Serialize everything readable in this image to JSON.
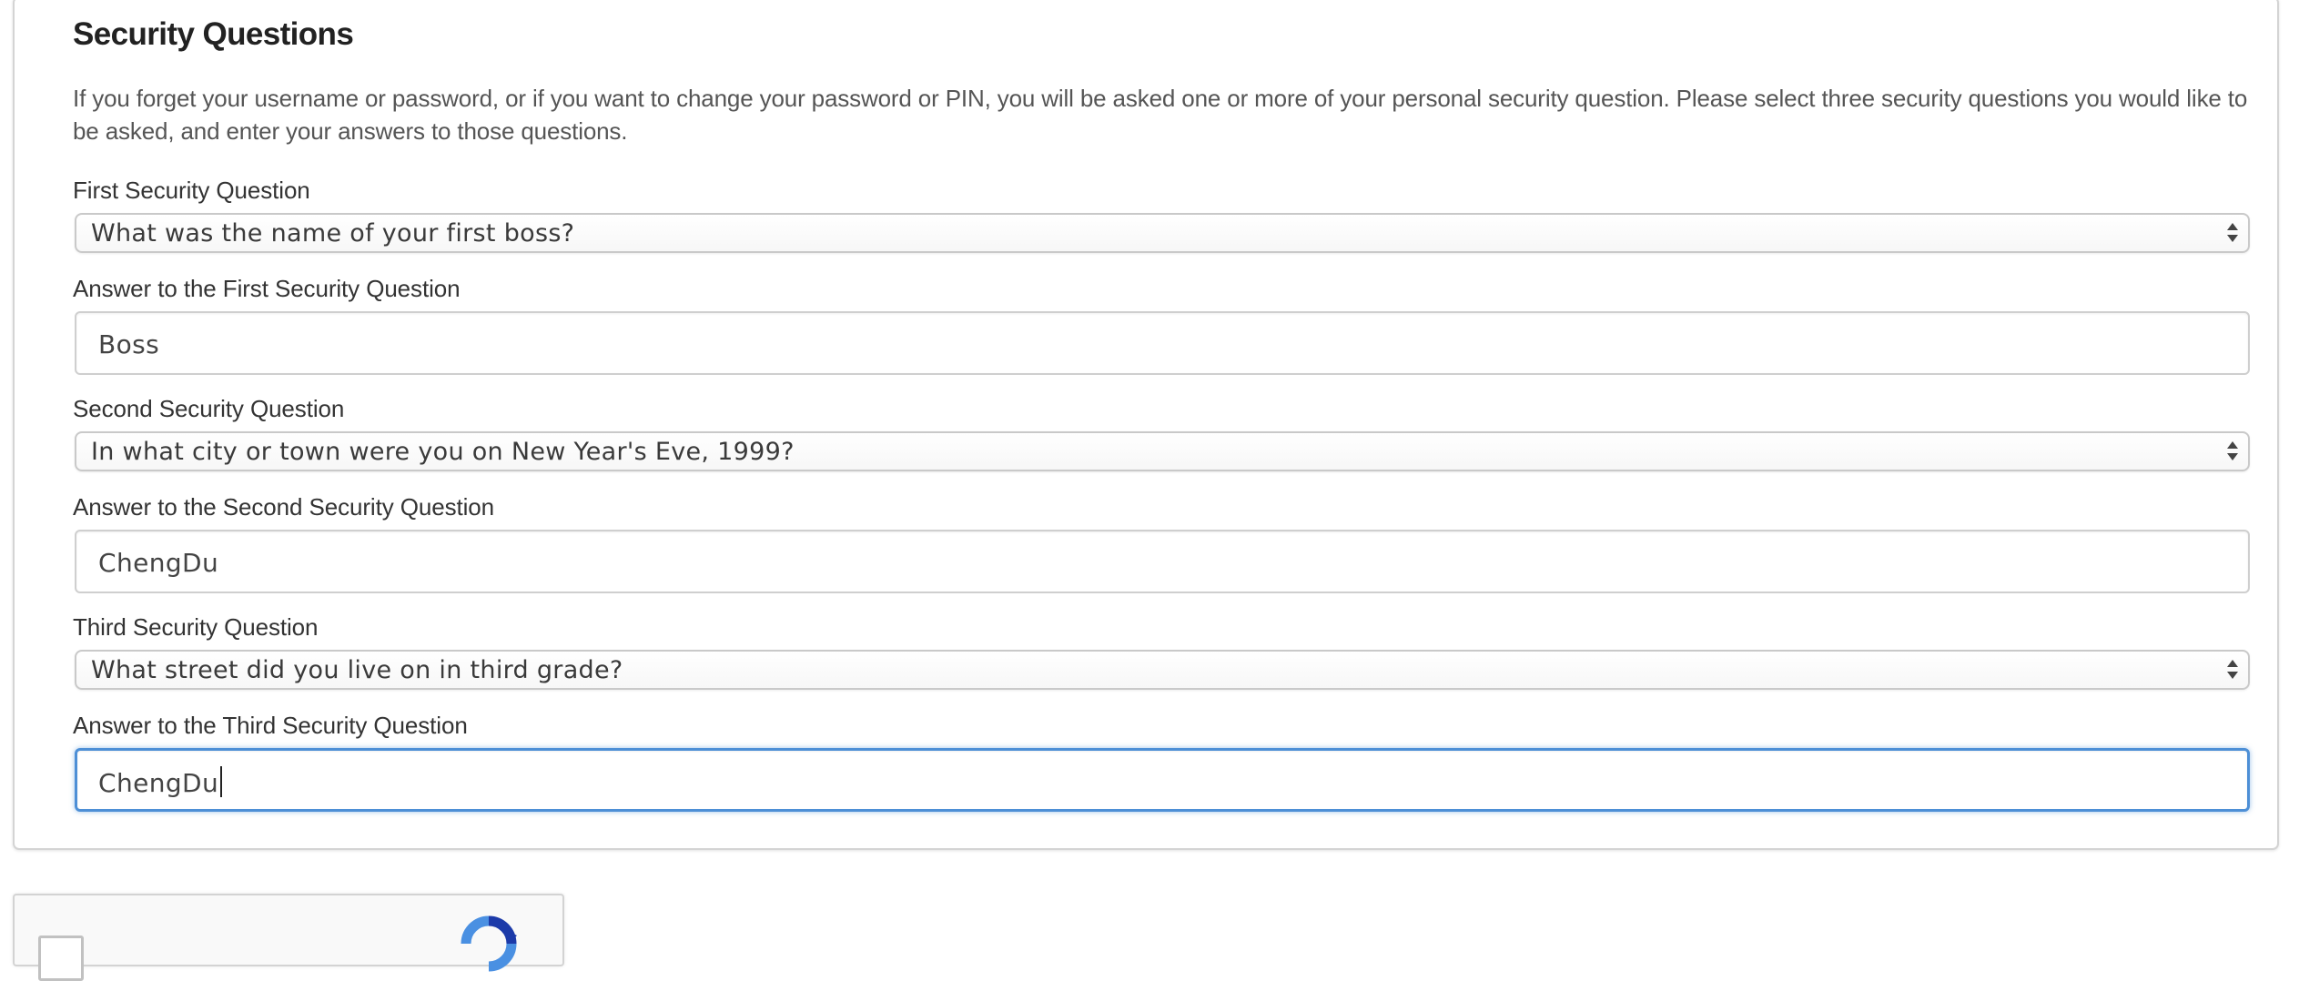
{
  "section": {
    "title": "Security Questions",
    "description": "If you forget your username or password, or if you want to change your password or PIN, you will be asked one or more of your personal security question. Please select three security questions you would like to be asked, and enter your answers to those questions."
  },
  "questions": [
    {
      "question_label": "First Security Question",
      "selected_question": "What was the name of your first boss?",
      "answer_label": "Answer to the First Security Question",
      "answer_value": "Boss"
    },
    {
      "question_label": "Second Security Question",
      "selected_question": "In what city or town were you on New Year's Eve, 1999?",
      "answer_label": "Answer to the Second Security Question",
      "answer_value": "ChengDu"
    },
    {
      "question_label": "Third Security Question",
      "selected_question": "What street did you live on in third grade?",
      "answer_label": "Answer to the Third Security Question",
      "answer_value": "ChengDu"
    }
  ],
  "focused_field": "third-answer-input",
  "icons": {
    "select_arrows": "updown-arrows-icon",
    "captcha_logo": "recaptcha-icon"
  },
  "colors": {
    "focus_border": "#4d8fd6",
    "recaptcha_blue": "#1c3aa9",
    "recaptcha_light_blue": "#4a90e2"
  }
}
